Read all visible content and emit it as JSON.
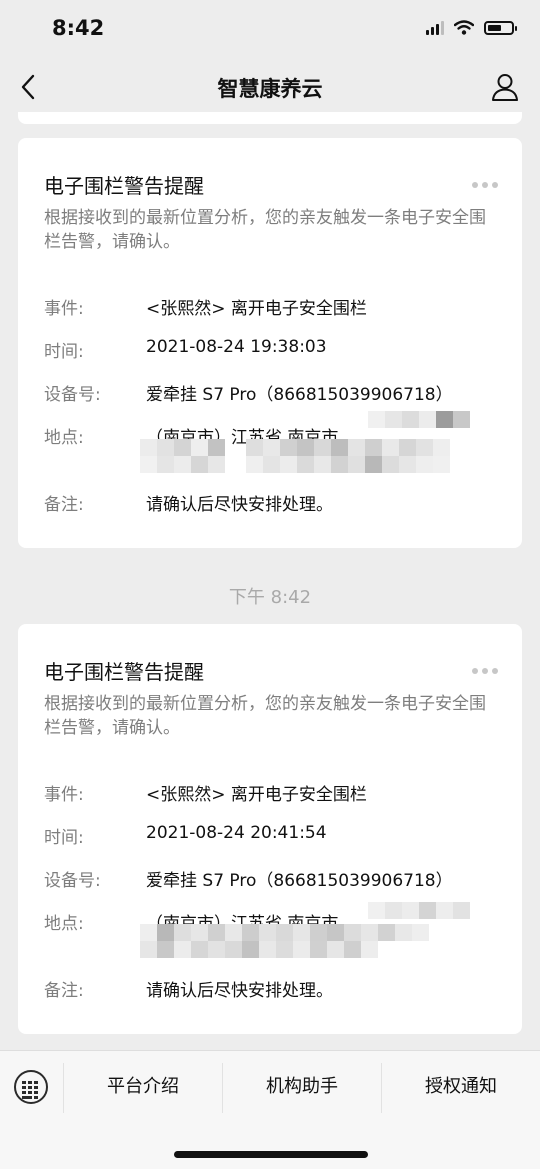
{
  "status_bar": {
    "time": "8:42",
    "battery_level": 0.6
  },
  "nav": {
    "title": "智慧康养云",
    "back_icon": "chevron-left-icon",
    "right_icon": "person-icon"
  },
  "messages": [
    {
      "title": "电子围栏警告提醒",
      "description": "根据接收到的最新位置分析，您的亲友触发一条电子安全围栏告警，请确认。",
      "fields": [
        {
          "label": "事件:",
          "value": "<张熙然> 离开电子安全围栏"
        },
        {
          "label": "时间:",
          "value": "2021-08-24 19:38:03"
        },
        {
          "label": "设备号:",
          "value": "爱牵挂 S7 Pro（866815039906718）"
        },
        {
          "label": "地点:",
          "value": "（南京市）江苏省 南京市"
        },
        {
          "label": "备注:",
          "value": "请确认后尽快安排处理。"
        }
      ]
    },
    {
      "title": "电子围栏警告提醒",
      "description": "根据接收到的最新位置分析，您的亲友触发一条电子安全围栏告警，请确认。",
      "fields": [
        {
          "label": "事件:",
          "value": "<张熙然> 离开电子安全围栏"
        },
        {
          "label": "时间:",
          "value": "2021-08-24 20:41:54"
        },
        {
          "label": "设备号:",
          "value": "爱牵挂 S7 Pro（866815039906718）"
        },
        {
          "label": "地点:",
          "value": "（南京市）江苏省 南京市"
        },
        {
          "label": "备注:",
          "value": "请确认后尽快安排处理。"
        }
      ]
    }
  ],
  "timestamp": "下午 8:42",
  "bottom_menu": {
    "keyboard_icon": "keyboard-icon",
    "items": [
      "平台介绍",
      "机构助手",
      "授权通知"
    ]
  },
  "colors": {
    "background": "#ededed",
    "card": "#ffffff",
    "muted_text": "#7e7e7e",
    "timestamp": "#a9a9a9"
  }
}
